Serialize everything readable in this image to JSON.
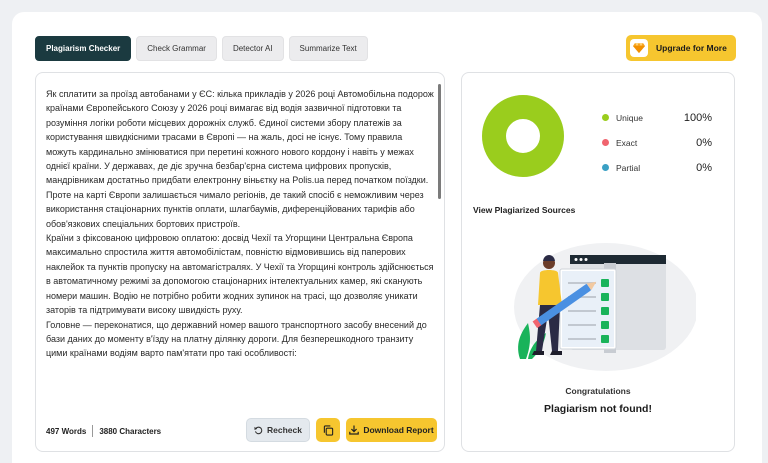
{
  "tabs": [
    {
      "label": "Plagiarism Checker",
      "active": true
    },
    {
      "label": "Check Grammar",
      "active": false
    },
    {
      "label": "Detector AI",
      "active": false
    },
    {
      "label": "Summarize Text",
      "active": false
    }
  ],
  "upgrade": {
    "label": "Upgrade for More",
    "icon": "diamond-icon"
  },
  "editor": {
    "paragraphs": [
      "Як сплатити за проїзд автобанами у ЄС: кілька прикладів у 2026 році Автомобільна подорож країнами Європейського Союзу у 2026 році вимагає від водія зазвичної підготовки та розуміння логіки роботи місцевих дорожніх служб. Єдиної системи збору платежів за користування швидкісними трасами в Європі — на жаль, досі не існує. Тому правила можуть кардинально змінюватися при перетині кожного нового кордону і навіть у межах однієї країни. У державах, де діє зручна безбар'єрна система цифрових пропусків, мандрівникам достатньо придбати електронну віньєтку на Polis.ua перед початком поїздки. Проте на карті Європи залишається чимало регіонів, де такий спосіб є неможливим через використання стаціонарних пунктів оплати, шлагбаумів, диференційованих тарифів або обов'язкових спеціальних бортових пристроїв.",
      "Країни з фіксованою цифровою оплатою: досвід Чехії та Угорщини Центральна Європа максимально спростила життя автомобілістам, повністю відмовившись від паперових наклейок та пунктів пропуску на автомагістралях. У Чехії та Угорщині контроль здійснюється в автоматичному режимі за допомогою стаціонарних інтелектуальних камер, які сканують номери машин. Водію не потрібно робити жодних зупинок на трасі, що дозволяє уникати заторів та підтримувати високу швидкість руху.",
      "Головне — переконатися, що державний номер вашого транспортного засобу внесений до бази даних до моменту в'їзду на платну ділянку дороги. Для безперешкодного транзиту цими країнами водіям варто пам'ятати про такі особливості:"
    ],
    "words": "497 Words",
    "characters": "3880 Characters",
    "recheck_label": "Recheck",
    "download_label": "Download Report"
  },
  "results": {
    "legend": [
      {
        "name": "Unique",
        "pct": "100%",
        "color": "#9acd1d"
      },
      {
        "name": "Exact",
        "pct": "0%",
        "color": "#f0646e"
      },
      {
        "name": "Partial",
        "pct": "0%",
        "color": "#3aa0c4"
      }
    ],
    "unique_fraction": 1.0,
    "view_title": "View Plagiarized Sources",
    "congrats": "Congratulations",
    "message": "Plagiarism not found!"
  },
  "colors": {
    "accent": "#f6c62f",
    "dark": "#1b3a40",
    "unique": "#9acd1d"
  }
}
